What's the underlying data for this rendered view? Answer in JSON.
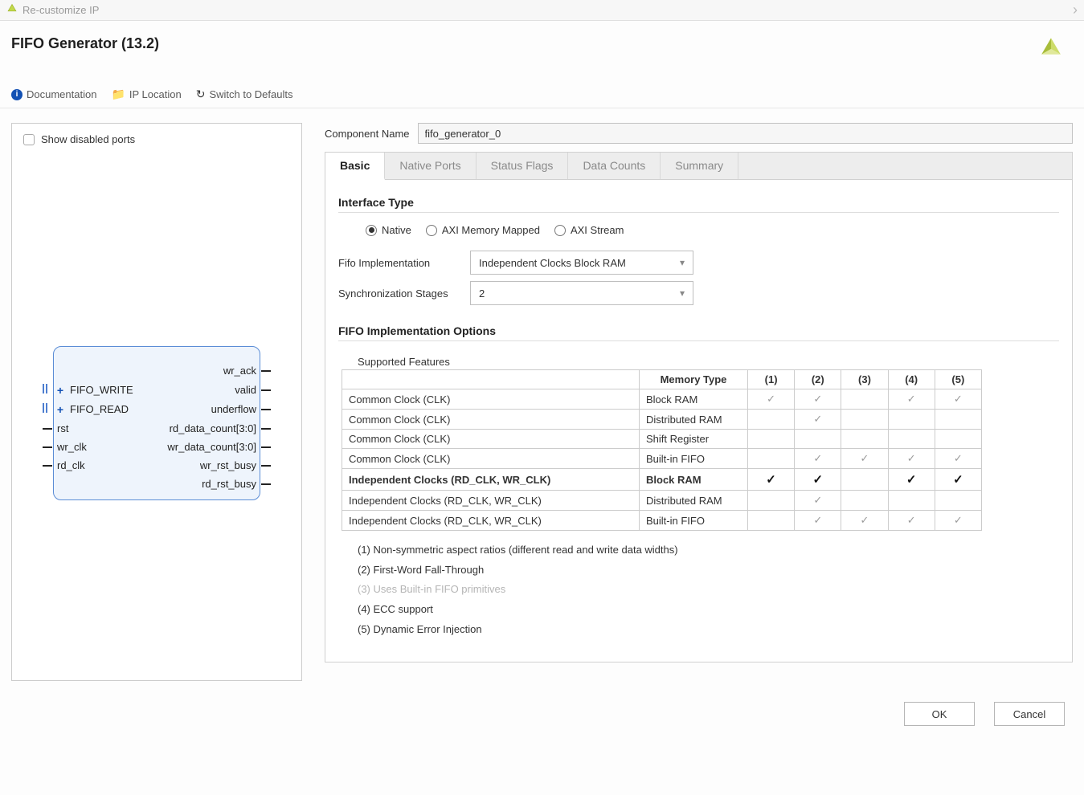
{
  "window": {
    "title": "Re-customize IP"
  },
  "header": {
    "title": "FIFO Generator (13.2)",
    "toolbar": {
      "documentation": "Documentation",
      "ip_location": "IP Location",
      "switch_defaults": "Switch to Defaults"
    }
  },
  "left": {
    "show_disabled_label": "Show disabled ports",
    "block": {
      "inputs_bus": [
        "FIFO_WRITE",
        "FIFO_READ"
      ],
      "inputs": [
        "rst",
        "wr_clk",
        "rd_clk"
      ],
      "outputs": [
        "wr_ack",
        "valid",
        "underflow",
        "rd_data_count[3:0]",
        "wr_data_count[3:0]",
        "wr_rst_busy",
        "rd_rst_busy"
      ]
    }
  },
  "right": {
    "component_label": "Component Name",
    "component_value": "fifo_generator_0",
    "tabs": [
      "Basic",
      "Native Ports",
      "Status Flags",
      "Data Counts",
      "Summary"
    ],
    "active_tab": 0,
    "basic": {
      "section_interface": "Interface Type",
      "radios": [
        "Native",
        "AXI Memory Mapped",
        "AXI Stream"
      ],
      "radio_selected": 0,
      "fifo_impl_label": "Fifo Implementation",
      "fifo_impl_value": "Independent Clocks Block RAM",
      "sync_stages_label": "Synchronization Stages",
      "sync_stages_value": "2",
      "section_options": "FIFO Implementation Options",
      "supported_label": "Supported Features",
      "table": {
        "headers": [
          "",
          "Memory Type",
          "(1)",
          "(2)",
          "(3)",
          "(4)",
          "(5)"
        ],
        "rows": [
          {
            "clock": "Common Clock (CLK)",
            "mem": "Block RAM",
            "marks": [
              "l",
              "l",
              "",
              "l",
              "l"
            ],
            "sel": false
          },
          {
            "clock": "Common Clock (CLK)",
            "mem": "Distributed RAM",
            "marks": [
              "",
              "l",
              "",
              "",
              ""
            ],
            "sel": false
          },
          {
            "clock": "Common Clock (CLK)",
            "mem": "Shift Register",
            "marks": [
              "",
              "",
              "",
              "",
              ""
            ],
            "sel": false
          },
          {
            "clock": "Common Clock (CLK)",
            "mem": "Built-in FIFO",
            "marks": [
              "",
              "l",
              "l",
              "l",
              "l"
            ],
            "sel": false
          },
          {
            "clock": "Independent Clocks (RD_CLK, WR_CLK)",
            "mem": "Block RAM",
            "marks": [
              "b",
              "b",
              "",
              "b",
              "b"
            ],
            "sel": true
          },
          {
            "clock": "Independent Clocks (RD_CLK, WR_CLK)",
            "mem": "Distributed RAM",
            "marks": [
              "",
              "l",
              "",
              "",
              ""
            ],
            "sel": false
          },
          {
            "clock": "Independent Clocks (RD_CLK, WR_CLK)",
            "mem": "Built-in FIFO",
            "marks": [
              "",
              "l",
              "l",
              "l",
              "l"
            ],
            "sel": false
          }
        ]
      },
      "notes": [
        {
          "text": "(1) Non-symmetric aspect ratios (different read and write data widths)",
          "muted": false
        },
        {
          "text": "(2) First-Word Fall-Through",
          "muted": false
        },
        {
          "text": "(3) Uses Built-in FIFO primitives",
          "muted": true
        },
        {
          "text": "(4) ECC support",
          "muted": false
        },
        {
          "text": "(5) Dynamic Error Injection",
          "muted": false
        }
      ]
    }
  },
  "footer": {
    "ok": "OK",
    "cancel": "Cancel"
  }
}
